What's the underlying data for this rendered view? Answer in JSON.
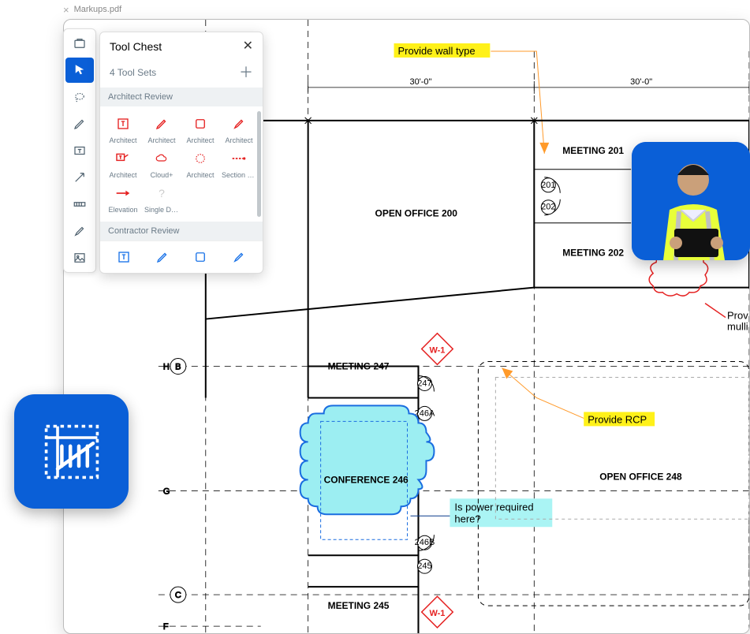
{
  "tab": {
    "filename": "Markups.pdf"
  },
  "toolchest": {
    "title": "Tool Chest",
    "subtitle": "4 Tool Sets",
    "section1": "Architect Review",
    "section2": "Contractor Review",
    "items": [
      {
        "label": "Architect"
      },
      {
        "label": "Architect"
      },
      {
        "label": "Architect"
      },
      {
        "label": "Architect"
      },
      {
        "label": "Architect"
      },
      {
        "label": "Cloud+"
      },
      {
        "label": "Architect"
      },
      {
        "label": "Section D..."
      },
      {
        "label": "Elevation"
      },
      {
        "label": "Single Do..."
      }
    ]
  },
  "plan": {
    "dimensions": {
      "span1": "30'-0\"",
      "span2": "30'-0\""
    },
    "rooms": {
      "open200": "OPEN OFFICE  200",
      "meeting201": "MEETING  201",
      "meeting202": "MEETING  202",
      "meeting247": "MEETING  247",
      "conference246": "CONFERENCE  246",
      "open248": "OPEN OFFICE  248",
      "meeting245": "MEETING  245"
    },
    "doors": {
      "d201": "201",
      "d202": "202",
      "d247": "247",
      "d246a": "246A",
      "d246b": "246B",
      "d245": "245"
    },
    "tags": {
      "w1": "W-1"
    },
    "callouts": {
      "wall_type": "Provide wall type",
      "rcp": "Provide RCP",
      "mullions": "Provide window\nmullions",
      "power": "Is power required here?"
    },
    "grid": {
      "b": "B",
      "c": "C",
      "f": "F",
      "g": "G",
      "h": "H"
    }
  }
}
